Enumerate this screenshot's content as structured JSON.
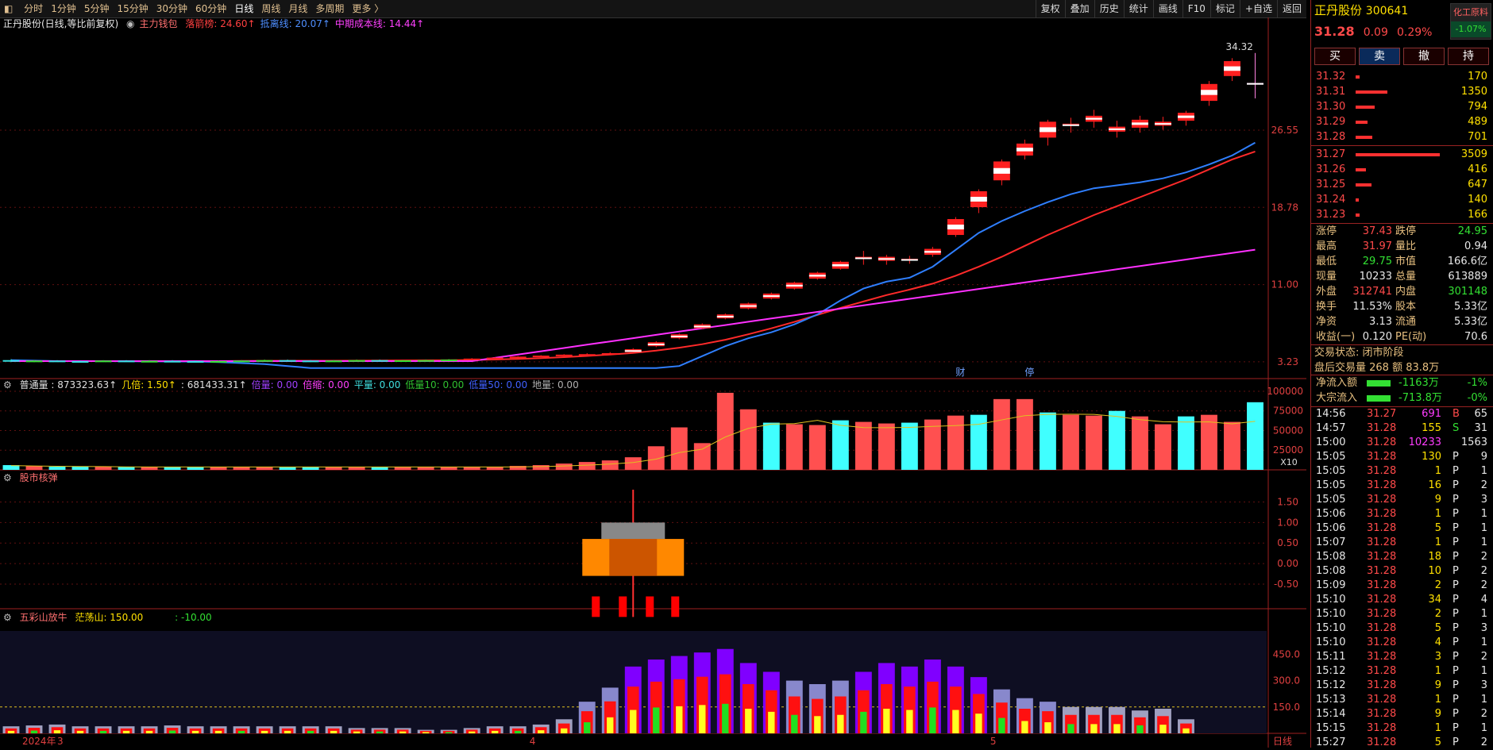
{
  "topbar": {
    "tabs": [
      "分时",
      "1分钟",
      "5分钟",
      "15分钟",
      "30分钟",
      "60分钟",
      "日线",
      "周线",
      "月线",
      "多周期",
      "更多 〉"
    ],
    "selected": "日线",
    "tools": [
      "复权",
      "叠加",
      "历史",
      "统计",
      "画线",
      "F10",
      "标记",
      "+自选",
      "返回"
    ]
  },
  "main_legend": {
    "title": "正丹股份(日线,等比前复权)",
    "indicator": "主力钱包",
    "items": [
      {
        "label": "落箭榜: 24.60↑",
        "color": "#ff4040"
      },
      {
        "label": "抵离线: 20.07↑",
        "color": "#4f8fff"
      },
      {
        "label": "中期成本线: 14.44↑",
        "color": "#ff40ff"
      }
    ],
    "high_label": "34.32",
    "markers": [
      "财",
      "停"
    ],
    "yticks": [
      "26.55",
      "18.78",
      "11.00",
      "3.23"
    ]
  },
  "volume_legend": {
    "items": [
      {
        "label": "普通量 : 873323.63↑",
        "color": "#e0e0e0"
      },
      {
        "label": "几倍: 1.50↑",
        "color": "#ffe000"
      },
      {
        "label": ": 681433.31↑",
        "color": "#e0e0e0"
      },
      {
        "label": "倍量: 0.00",
        "color": "#a040ff"
      },
      {
        "label": "倍缩: 0.00",
        "color": "#ff40ff"
      },
      {
        "label": "平量: 0.00",
        "color": "#40e0e0"
      },
      {
        "label": "低量10: 0.00",
        "color": "#30c030"
      },
      {
        "label": "低量50: 0.00",
        "color": "#4060ff"
      },
      {
        "label": "地量: 0.00",
        "color": "#b0b0b0"
      }
    ],
    "yticks": [
      "100000",
      "75000",
      "50000",
      "25000"
    ],
    "unit": "X10"
  },
  "panel3": {
    "title": "股市核弹",
    "yticks": [
      "1.50",
      "1.00",
      "0.50",
      "0.00",
      "-0.50"
    ]
  },
  "panel4": {
    "title": "五彩山放牛",
    "label1": "茫荡山: 150.00",
    "label2": ": -10.00",
    "yticks": [
      "450.0",
      "300.0",
      "150.0"
    ]
  },
  "xaxis": {
    "labels": [
      "2024年",
      "3",
      "4",
      "5"
    ],
    "right": "日线"
  },
  "quote": {
    "name": "正丹股份",
    "code": "300641",
    "sector": "化工原料",
    "sector_chg": "-1.07%",
    "price": "31.28",
    "change": "0.09",
    "pct": "0.29%",
    "buttons": [
      "买",
      "卖",
      "撤",
      "持"
    ]
  },
  "sells": [
    {
      "price": "31.32",
      "vol": "170",
      "frac": 0.05
    },
    {
      "price": "31.31",
      "vol": "1350",
      "frac": 0.38
    },
    {
      "price": "31.30",
      "vol": "794",
      "frac": 0.23
    },
    {
      "price": "31.29",
      "vol": "489",
      "frac": 0.14
    },
    {
      "price": "31.28",
      "vol": "701",
      "frac": 0.2
    }
  ],
  "buys": [
    {
      "price": "31.27",
      "vol": "3509",
      "frac": 1.0
    },
    {
      "price": "31.26",
      "vol": "416",
      "frac": 0.12
    },
    {
      "price": "31.25",
      "vol": "647",
      "frac": 0.19
    },
    {
      "price": "31.24",
      "vol": "140",
      "frac": 0.04
    },
    {
      "price": "31.23",
      "vol": "166",
      "frac": 0.05
    }
  ],
  "stats": [
    [
      "涨停",
      "37.43",
      "red",
      "跌停",
      "24.95",
      "grn"
    ],
    [
      "最高",
      "31.97",
      "red",
      "量比",
      "0.94",
      "wht"
    ],
    [
      "最低",
      "29.75",
      "grn",
      "市值",
      "166.6亿",
      "wht"
    ],
    [
      "现量",
      "10233",
      "wht",
      "总量",
      "613889",
      "wht"
    ],
    [
      "外盘",
      "312741",
      "red",
      "内盘",
      "301148",
      "grn"
    ],
    [
      "换手",
      "11.53%",
      "wht",
      "股本",
      "5.33亿",
      "wht"
    ],
    [
      "净资",
      "3.13",
      "wht",
      "流通",
      "5.33亿",
      "wht"
    ],
    [
      "收益(一)",
      "0.120",
      "wht",
      "PE(动)",
      "70.6",
      "wht"
    ]
  ],
  "status": {
    "state": "交易状态: 闭市阶段",
    "after": "盘后交易量 268 额 83.8万"
  },
  "flows": [
    {
      "label": "净流入额",
      "value": "-1163万",
      "pct": "-1%"
    },
    {
      "label": "大宗流入",
      "value": "-713.8万",
      "pct": "-0%"
    }
  ],
  "ticks": [
    [
      "14:56",
      "31.27",
      "691",
      "B",
      "65"
    ],
    [
      "14:57",
      "31.28",
      "155",
      "S",
      "31"
    ],
    [
      "15:00",
      "31.28",
      "10233",
      "",
      "1563"
    ],
    [
      "15:05",
      "31.28",
      "130",
      "P",
      "9"
    ],
    [
      "15:05",
      "31.28",
      "1",
      "P",
      "1"
    ],
    [
      "15:05",
      "31.28",
      "16",
      "P",
      "2"
    ],
    [
      "15:05",
      "31.28",
      "9",
      "P",
      "3"
    ],
    [
      "15:06",
      "31.28",
      "1",
      "P",
      "1"
    ],
    [
      "15:06",
      "31.28",
      "5",
      "P",
      "1"
    ],
    [
      "15:07",
      "31.28",
      "1",
      "P",
      "1"
    ],
    [
      "15:08",
      "31.28",
      "18",
      "P",
      "2"
    ],
    [
      "15:08",
      "31.28",
      "10",
      "P",
      "2"
    ],
    [
      "15:09",
      "31.28",
      "2",
      "P",
      "2"
    ],
    [
      "15:10",
      "31.28",
      "34",
      "P",
      "4"
    ],
    [
      "15:10",
      "31.28",
      "2",
      "P",
      "1"
    ],
    [
      "15:10",
      "31.28",
      "5",
      "P",
      "3"
    ],
    [
      "15:10",
      "31.28",
      "4",
      "P",
      "1"
    ],
    [
      "15:11",
      "31.28",
      "3",
      "P",
      "2"
    ],
    [
      "15:12",
      "31.28",
      "1",
      "P",
      "1"
    ],
    [
      "15:12",
      "31.28",
      "9",
      "P",
      "3"
    ],
    [
      "15:13",
      "31.28",
      "1",
      "P",
      "1"
    ],
    [
      "15:14",
      "31.28",
      "9",
      "P",
      "2"
    ],
    [
      "15:15",
      "31.28",
      "1",
      "P",
      "1"
    ],
    [
      "15:27",
      "31.28",
      "5",
      "P",
      "2"
    ]
  ],
  "chart_data": {
    "type": "candlestick",
    "candles": [
      [
        3.4,
        3.5,
        3.2,
        3.3
      ],
      [
        3.3,
        3.4,
        3.2,
        3.35
      ],
      [
        3.35,
        3.4,
        3.25,
        3.3
      ],
      [
        3.3,
        3.35,
        3.2,
        3.28
      ],
      [
        3.28,
        3.4,
        3.2,
        3.35
      ],
      [
        3.35,
        3.4,
        3.25,
        3.3
      ],
      [
        3.3,
        3.4,
        3.2,
        3.32
      ],
      [
        3.32,
        3.4,
        3.25,
        3.3
      ],
      [
        3.3,
        3.35,
        3.2,
        3.25
      ],
      [
        3.25,
        3.35,
        3.2,
        3.3
      ],
      [
        3.3,
        3.4,
        3.25,
        3.35
      ],
      [
        3.35,
        3.45,
        3.3,
        3.4
      ],
      [
        3.4,
        3.45,
        3.3,
        3.35
      ],
      [
        3.35,
        3.4,
        3.25,
        3.3
      ],
      [
        3.3,
        3.4,
        3.25,
        3.35
      ],
      [
        3.35,
        3.45,
        3.3,
        3.4
      ],
      [
        3.4,
        3.45,
        3.3,
        3.35
      ],
      [
        3.35,
        3.4,
        3.3,
        3.38
      ],
      [
        3.38,
        3.45,
        3.3,
        3.4
      ],
      [
        3.4,
        3.5,
        3.35,
        3.45
      ],
      [
        3.45,
        3.6,
        3.4,
        3.55
      ],
      [
        3.55,
        3.7,
        3.5,
        3.65
      ],
      [
        3.65,
        3.8,
        3.6,
        3.75
      ],
      [
        3.75,
        3.9,
        3.7,
        3.85
      ],
      [
        3.85,
        4.0,
        3.8,
        3.95
      ],
      [
        3.95,
        4.1,
        3.9,
        4.0
      ],
      [
        4.0,
        4.2,
        3.95,
        4.1
      ],
      [
        4.2,
        4.6,
        4.1,
        4.5
      ],
      [
        4.8,
        5.3,
        4.7,
        5.2
      ],
      [
        5.6,
        6.1,
        5.5,
        6.0
      ],
      [
        6.6,
        7.1,
        6.5,
        7.0
      ],
      [
        7.6,
        8.1,
        7.5,
        8.0
      ],
      [
        8.6,
        9.2,
        8.5,
        9.1
      ],
      [
        9.6,
        10.2,
        9.5,
        10.1
      ],
      [
        10.6,
        11.3,
        10.5,
        11.2
      ],
      [
        11.6,
        12.3,
        11.5,
        12.2
      ],
      [
        12.6,
        13.4,
        12.5,
        13.3
      ],
      [
        13.6,
        14.4,
        13.0,
        13.8
      ],
      [
        13.4,
        14.0,
        13.0,
        13.8
      ],
      [
        13.5,
        13.9,
        13.1,
        13.6
      ],
      [
        14.0,
        14.8,
        13.8,
        14.6
      ],
      [
        16.0,
        17.8,
        15.8,
        17.6
      ],
      [
        18.8,
        20.6,
        18.2,
        20.4
      ],
      [
        21.5,
        23.6,
        21.0,
        23.4
      ],
      [
        24.0,
        25.6,
        23.6,
        25.2
      ],
      [
        25.8,
        27.6,
        25.0,
        27.4
      ],
      [
        27.0,
        27.8,
        26.3,
        27.2
      ],
      [
        27.4,
        28.6,
        26.8,
        28.0
      ],
      [
        26.4,
        27.5,
        25.8,
        26.9
      ],
      [
        26.8,
        28.0,
        26.3,
        27.6
      ],
      [
        27.0,
        27.9,
        26.6,
        27.4
      ],
      [
        27.5,
        28.5,
        27.0,
        28.3
      ],
      [
        29.5,
        31.5,
        29.0,
        31.2
      ],
      [
        32.0,
        33.8,
        31.5,
        33.5
      ],
      [
        31.3,
        34.32,
        29.75,
        31.28
      ]
    ],
    "ma": {
      "red": [
        3.3,
        3.3,
        3.3,
        3.3,
        3.3,
        3.3,
        3.3,
        3.3,
        3.3,
        3.3,
        3.32,
        3.33,
        3.34,
        3.34,
        3.34,
        3.35,
        3.36,
        3.37,
        3.38,
        3.39,
        3.42,
        3.46,
        3.52,
        3.6,
        3.7,
        3.82,
        3.96,
        4.12,
        4.35,
        4.65,
        5.0,
        5.45,
        6.0,
        6.6,
        7.25,
        7.95,
        8.65,
        9.3,
        9.95,
        10.5,
        11.1,
        11.9,
        12.8,
        13.8,
        14.9,
        16.0,
        17.0,
        18.0,
        18.9,
        19.8,
        20.7,
        21.6,
        22.6,
        23.6,
        24.4
      ],
      "blue": [
        3.4,
        3.35,
        3.3,
        3.3,
        3.3,
        3.28,
        3.27,
        3.26,
        3.25,
        3.2,
        3.1,
        3.0,
        2.8,
        2.5,
        2.2,
        1.8,
        1.3,
        0.7,
        0.1,
        -0.5,
        -1.0,
        -1.4,
        -1.6,
        -1.5,
        -1.2,
        -0.8,
        -0.2,
        0.6,
        1.6,
        2.8,
        3.8,
        4.8,
        5.6,
        6.2,
        7.0,
        8.0,
        9.4,
        10.6,
        11.3,
        11.7,
        12.8,
        14.5,
        16.2,
        17.4,
        18.4,
        19.3,
        20.1,
        20.7,
        21.0,
        21.3,
        21.7,
        22.3,
        23.1,
        24.0,
        25.3
      ]
    },
    "volume": [
      6,
      5,
      4,
      4,
      4,
      4,
      4,
      4,
      4,
      4,
      4,
      4,
      4,
      4,
      4,
      4,
      4,
      4,
      4,
      4,
      4,
      4,
      5,
      6,
      8,
      10,
      12,
      16,
      30,
      54,
      34,
      98,
      77,
      60,
      58,
      57,
      63,
      61,
      59,
      60,
      64,
      69,
      70,
      90,
      90,
      73,
      70,
      69,
      75,
      68,
      58,
      68,
      70,
      61,
      86
    ],
    "mood": [
      40,
      45,
      50,
      40,
      40,
      40,
      40,
      45,
      40,
      40,
      40,
      40,
      40,
      40,
      40,
      30,
      30,
      30,
      20,
      20,
      30,
      40,
      40,
      50,
      80,
      180,
      260,
      380,
      420,
      440,
      460,
      480,
      400,
      350,
      300,
      280,
      300,
      350,
      400,
      380,
      420,
      380,
      320,
      250,
      200,
      180,
      150,
      150,
      150,
      130,
      140,
      80
    ]
  }
}
